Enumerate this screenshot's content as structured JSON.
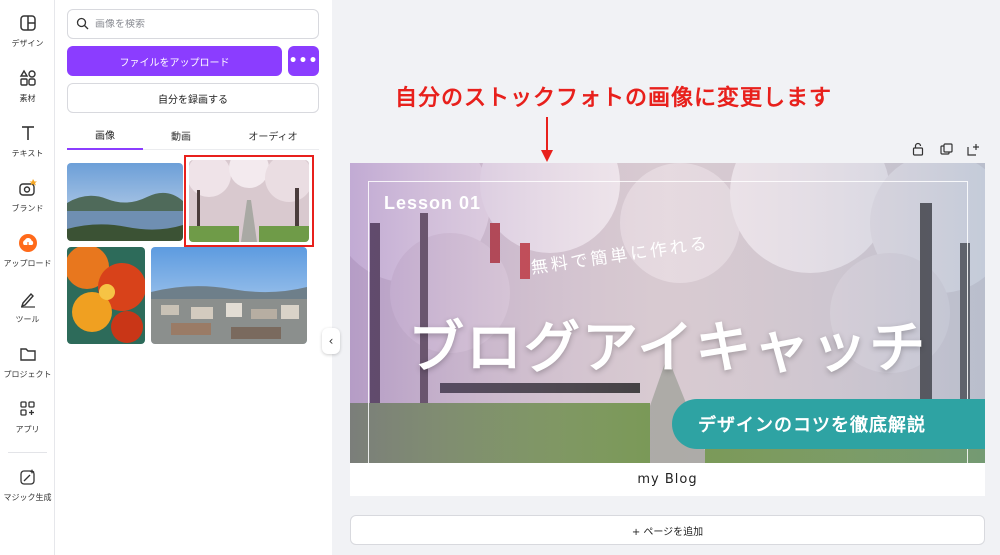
{
  "rail": {
    "items": [
      {
        "label": "デザイン",
        "icon": "layout-icon"
      },
      {
        "label": "素材",
        "icon": "shapes-icon"
      },
      {
        "label": "テキスト",
        "icon": "text-icon"
      },
      {
        "label": "ブランド",
        "icon": "brand-icon"
      },
      {
        "label": "アップロード",
        "icon": "upload-cloud-icon"
      },
      {
        "label": "ツール",
        "icon": "pen-icon"
      },
      {
        "label": "プロジェクト",
        "icon": "folder-icon"
      },
      {
        "label": "アプリ",
        "icon": "apps-icon"
      },
      {
        "label": "マジック生成",
        "icon": "magic-icon"
      }
    ]
  },
  "panel": {
    "search_placeholder": "画像を検索",
    "upload_label": "ファイルをアップロード",
    "more_label": "•••",
    "record_label": "自分を録画する",
    "tabs": [
      "画像",
      "動画",
      "オーディオ"
    ],
    "active_tab": 0
  },
  "annotation": {
    "text": "自分のストックフォトの画像に変更します",
    "color": "#e8201c"
  },
  "design": {
    "lesson": "Lesson 01",
    "tagline": "無料で簡単に作れる",
    "headline": "ブログアイキャッチ",
    "pill_text": "デザインのコツを徹底解説",
    "footer": "my Blog"
  },
  "canvas": {
    "add_page_label": "+ ページを追加"
  },
  "colors": {
    "accent": "#8b3dff",
    "teal": "#2ea3a3",
    "highlight": "#e8201c"
  }
}
